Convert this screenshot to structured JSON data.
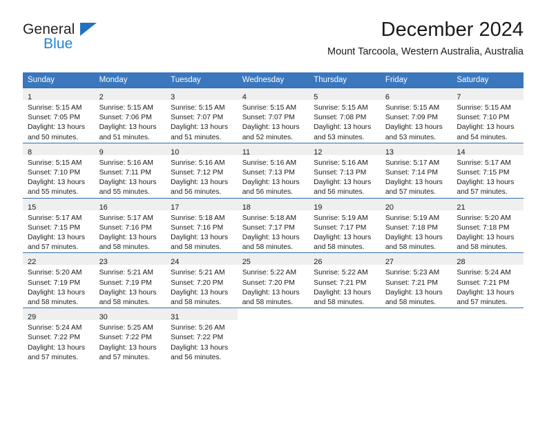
{
  "brand": {
    "name_part1": "General",
    "name_part2": "Blue",
    "triangle_color": "#1f72bd",
    "blue_text_color": "#1f84d6"
  },
  "header": {
    "title": "December 2024",
    "subtitle": "Mount Tarcoola, Western Australia, Australia"
  },
  "theme": {
    "header_band": "#3a77bd",
    "row_divider": "#2f6dab",
    "day_band": "#efefef",
    "text": "#1a1a1a"
  },
  "weekday_headers": [
    "Sunday",
    "Monday",
    "Tuesday",
    "Wednesday",
    "Thursday",
    "Friday",
    "Saturday"
  ],
  "weeks": [
    [
      {
        "day": "1",
        "sunrise": "Sunrise: 5:15 AM",
        "sunset": "Sunset: 7:05 PM",
        "daylight": "Daylight: 13 hours and 50 minutes."
      },
      {
        "day": "2",
        "sunrise": "Sunrise: 5:15 AM",
        "sunset": "Sunset: 7:06 PM",
        "daylight": "Daylight: 13 hours and 51 minutes."
      },
      {
        "day": "3",
        "sunrise": "Sunrise: 5:15 AM",
        "sunset": "Sunset: 7:07 PM",
        "daylight": "Daylight: 13 hours and 51 minutes."
      },
      {
        "day": "4",
        "sunrise": "Sunrise: 5:15 AM",
        "sunset": "Sunset: 7:07 PM",
        "daylight": "Daylight: 13 hours and 52 minutes."
      },
      {
        "day": "5",
        "sunrise": "Sunrise: 5:15 AM",
        "sunset": "Sunset: 7:08 PM",
        "daylight": "Daylight: 13 hours and 53 minutes."
      },
      {
        "day": "6",
        "sunrise": "Sunrise: 5:15 AM",
        "sunset": "Sunset: 7:09 PM",
        "daylight": "Daylight: 13 hours and 53 minutes."
      },
      {
        "day": "7",
        "sunrise": "Sunrise: 5:15 AM",
        "sunset": "Sunset: 7:10 PM",
        "daylight": "Daylight: 13 hours and 54 minutes."
      }
    ],
    [
      {
        "day": "8",
        "sunrise": "Sunrise: 5:15 AM",
        "sunset": "Sunset: 7:10 PM",
        "daylight": "Daylight: 13 hours and 55 minutes."
      },
      {
        "day": "9",
        "sunrise": "Sunrise: 5:16 AM",
        "sunset": "Sunset: 7:11 PM",
        "daylight": "Daylight: 13 hours and 55 minutes."
      },
      {
        "day": "10",
        "sunrise": "Sunrise: 5:16 AM",
        "sunset": "Sunset: 7:12 PM",
        "daylight": "Daylight: 13 hours and 56 minutes."
      },
      {
        "day": "11",
        "sunrise": "Sunrise: 5:16 AM",
        "sunset": "Sunset: 7:13 PM",
        "daylight": "Daylight: 13 hours and 56 minutes."
      },
      {
        "day": "12",
        "sunrise": "Sunrise: 5:16 AM",
        "sunset": "Sunset: 7:13 PM",
        "daylight": "Daylight: 13 hours and 56 minutes."
      },
      {
        "day": "13",
        "sunrise": "Sunrise: 5:17 AM",
        "sunset": "Sunset: 7:14 PM",
        "daylight": "Daylight: 13 hours and 57 minutes."
      },
      {
        "day": "14",
        "sunrise": "Sunrise: 5:17 AM",
        "sunset": "Sunset: 7:15 PM",
        "daylight": "Daylight: 13 hours and 57 minutes."
      }
    ],
    [
      {
        "day": "15",
        "sunrise": "Sunrise: 5:17 AM",
        "sunset": "Sunset: 7:15 PM",
        "daylight": "Daylight: 13 hours and 57 minutes."
      },
      {
        "day": "16",
        "sunrise": "Sunrise: 5:17 AM",
        "sunset": "Sunset: 7:16 PM",
        "daylight": "Daylight: 13 hours and 58 minutes."
      },
      {
        "day": "17",
        "sunrise": "Sunrise: 5:18 AM",
        "sunset": "Sunset: 7:16 PM",
        "daylight": "Daylight: 13 hours and 58 minutes."
      },
      {
        "day": "18",
        "sunrise": "Sunrise: 5:18 AM",
        "sunset": "Sunset: 7:17 PM",
        "daylight": "Daylight: 13 hours and 58 minutes."
      },
      {
        "day": "19",
        "sunrise": "Sunrise: 5:19 AM",
        "sunset": "Sunset: 7:17 PM",
        "daylight": "Daylight: 13 hours and 58 minutes."
      },
      {
        "day": "20",
        "sunrise": "Sunrise: 5:19 AM",
        "sunset": "Sunset: 7:18 PM",
        "daylight": "Daylight: 13 hours and 58 minutes."
      },
      {
        "day": "21",
        "sunrise": "Sunrise: 5:20 AM",
        "sunset": "Sunset: 7:18 PM",
        "daylight": "Daylight: 13 hours and 58 minutes."
      }
    ],
    [
      {
        "day": "22",
        "sunrise": "Sunrise: 5:20 AM",
        "sunset": "Sunset: 7:19 PM",
        "daylight": "Daylight: 13 hours and 58 minutes."
      },
      {
        "day": "23",
        "sunrise": "Sunrise: 5:21 AM",
        "sunset": "Sunset: 7:19 PM",
        "daylight": "Daylight: 13 hours and 58 minutes."
      },
      {
        "day": "24",
        "sunrise": "Sunrise: 5:21 AM",
        "sunset": "Sunset: 7:20 PM",
        "daylight": "Daylight: 13 hours and 58 minutes."
      },
      {
        "day": "25",
        "sunrise": "Sunrise: 5:22 AM",
        "sunset": "Sunset: 7:20 PM",
        "daylight": "Daylight: 13 hours and 58 minutes."
      },
      {
        "day": "26",
        "sunrise": "Sunrise: 5:22 AM",
        "sunset": "Sunset: 7:21 PM",
        "daylight": "Daylight: 13 hours and 58 minutes."
      },
      {
        "day": "27",
        "sunrise": "Sunrise: 5:23 AM",
        "sunset": "Sunset: 7:21 PM",
        "daylight": "Daylight: 13 hours and 58 minutes."
      },
      {
        "day": "28",
        "sunrise": "Sunrise: 5:24 AM",
        "sunset": "Sunset: 7:21 PM",
        "daylight": "Daylight: 13 hours and 57 minutes."
      }
    ],
    [
      {
        "day": "29",
        "sunrise": "Sunrise: 5:24 AM",
        "sunset": "Sunset: 7:22 PM",
        "daylight": "Daylight: 13 hours and 57 minutes."
      },
      {
        "day": "30",
        "sunrise": "Sunrise: 5:25 AM",
        "sunset": "Sunset: 7:22 PM",
        "daylight": "Daylight: 13 hours and 57 minutes."
      },
      {
        "day": "31",
        "sunrise": "Sunrise: 5:26 AM",
        "sunset": "Sunset: 7:22 PM",
        "daylight": "Daylight: 13 hours and 56 minutes."
      },
      null,
      null,
      null,
      null
    ]
  ]
}
